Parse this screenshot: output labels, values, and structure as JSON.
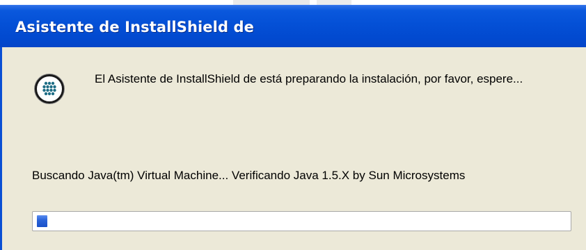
{
  "window": {
    "title": "Asistente de InstallShield de"
  },
  "dialog": {
    "icon": "installshield-logo-icon",
    "message": "El Asistente de InstallShield de está preparando la instalación, por favor, espere...",
    "status_text": "Buscando Java(tm) Virtual Machine... Verificando Java 1.5.X by Sun Microsystems"
  },
  "progress": {
    "fraction": 0.02
  },
  "colors": {
    "titlebar": "#0450d6",
    "background": "#ece9d8",
    "progress_fill": "#2b64d8"
  }
}
